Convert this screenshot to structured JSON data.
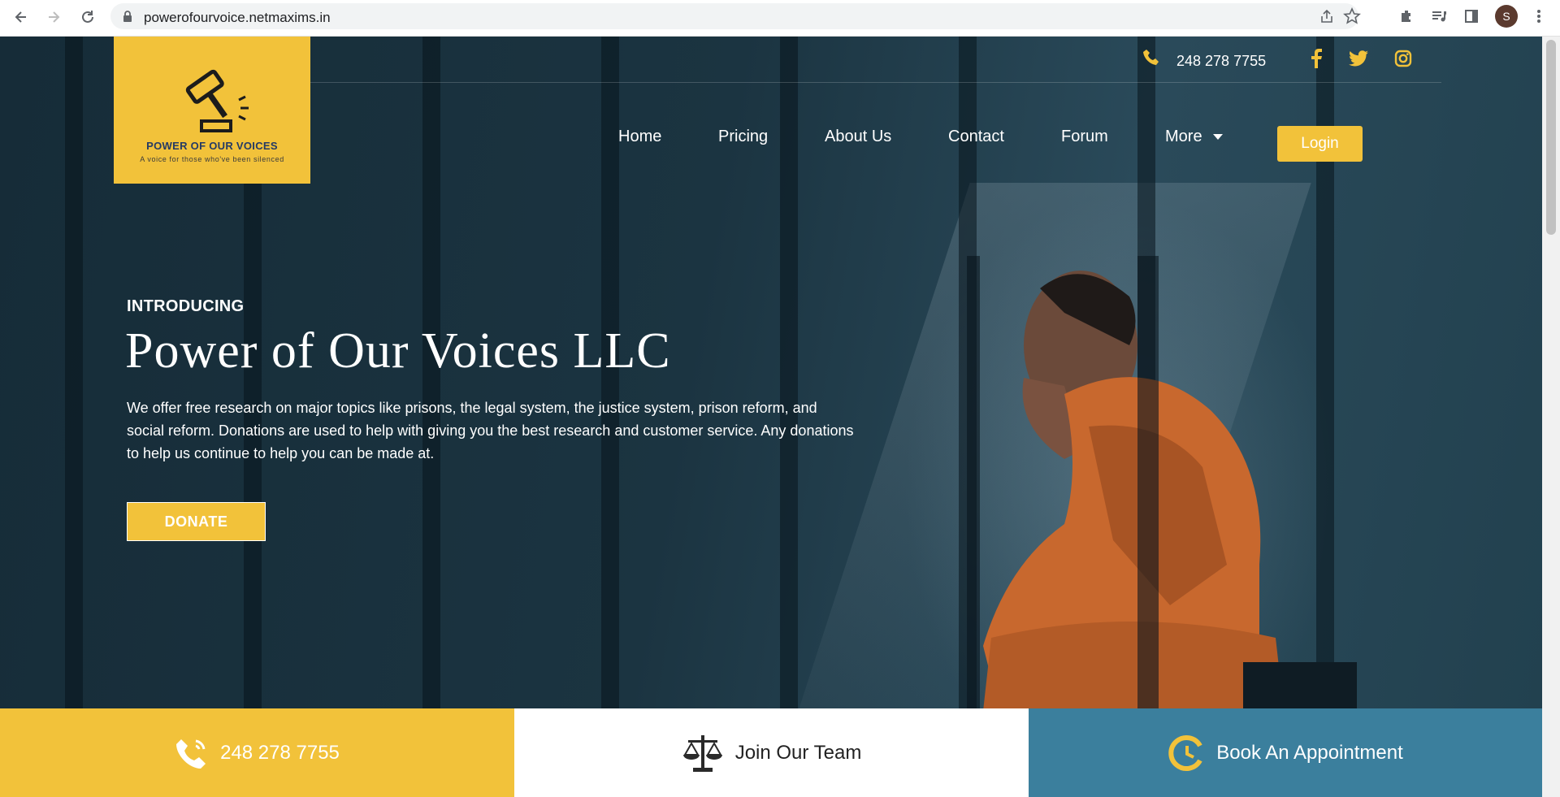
{
  "browser": {
    "url": "powerofourvoice.netmaxims.in",
    "avatar_letter": "S"
  },
  "header": {
    "logo_title": "POWER OF OUR VOICES",
    "logo_tagline": "A voice for those who've been silenced",
    "phone": "248 278 7755",
    "nav": [
      "Home",
      "Pricing",
      "About Us",
      "Contact",
      "Forum",
      "More"
    ],
    "login_label": "Login"
  },
  "hero": {
    "eyebrow": "INTRODUCING",
    "title": "Power of Our Voices LLC",
    "description": "We offer free research on major topics like prisons, the legal system, the justice system, prison reform, and social reform. Donations are used to help with giving you the best research and customer service. Any donations to help us continue to help you can be made at.",
    "donate_label": "DONATE"
  },
  "strip": {
    "phone": "248 278 7755",
    "join": "Join Our Team",
    "book": "Book An Appointment"
  },
  "colors": {
    "accent": "#f2c23a",
    "teal": "#3b7f9d",
    "hero_dark": "#1c3340"
  }
}
